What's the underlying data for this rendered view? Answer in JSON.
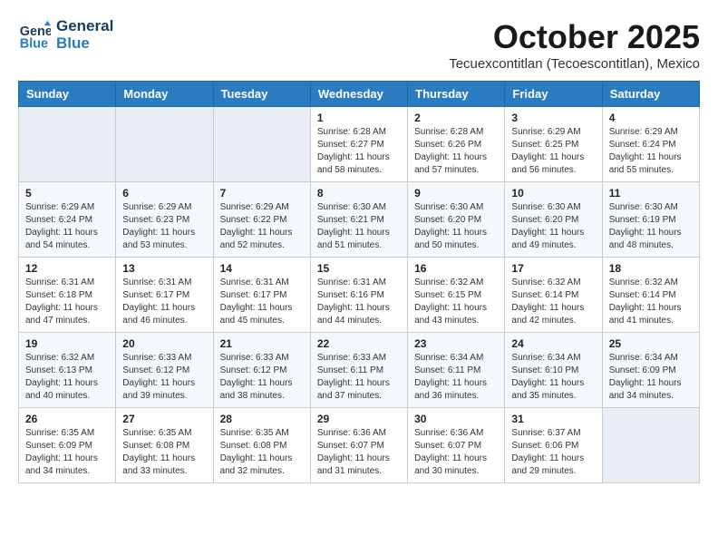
{
  "header": {
    "logo_line1": "General",
    "logo_line2": "Blue",
    "month": "October 2025",
    "location": "Tecuexcontitlan (Tecoescontitlan), Mexico"
  },
  "weekdays": [
    "Sunday",
    "Monday",
    "Tuesday",
    "Wednesday",
    "Thursday",
    "Friday",
    "Saturday"
  ],
  "weeks": [
    [
      {
        "day": "",
        "info": ""
      },
      {
        "day": "",
        "info": ""
      },
      {
        "day": "",
        "info": ""
      },
      {
        "day": "1",
        "info": "Sunrise: 6:28 AM\nSunset: 6:27 PM\nDaylight: 11 hours\nand 58 minutes."
      },
      {
        "day": "2",
        "info": "Sunrise: 6:28 AM\nSunset: 6:26 PM\nDaylight: 11 hours\nand 57 minutes."
      },
      {
        "day": "3",
        "info": "Sunrise: 6:29 AM\nSunset: 6:25 PM\nDaylight: 11 hours\nand 56 minutes."
      },
      {
        "day": "4",
        "info": "Sunrise: 6:29 AM\nSunset: 6:24 PM\nDaylight: 11 hours\nand 55 minutes."
      }
    ],
    [
      {
        "day": "5",
        "info": "Sunrise: 6:29 AM\nSunset: 6:24 PM\nDaylight: 11 hours\nand 54 minutes."
      },
      {
        "day": "6",
        "info": "Sunrise: 6:29 AM\nSunset: 6:23 PM\nDaylight: 11 hours\nand 53 minutes."
      },
      {
        "day": "7",
        "info": "Sunrise: 6:29 AM\nSunset: 6:22 PM\nDaylight: 11 hours\nand 52 minutes."
      },
      {
        "day": "8",
        "info": "Sunrise: 6:30 AM\nSunset: 6:21 PM\nDaylight: 11 hours\nand 51 minutes."
      },
      {
        "day": "9",
        "info": "Sunrise: 6:30 AM\nSunset: 6:20 PM\nDaylight: 11 hours\nand 50 minutes."
      },
      {
        "day": "10",
        "info": "Sunrise: 6:30 AM\nSunset: 6:20 PM\nDaylight: 11 hours\nand 49 minutes."
      },
      {
        "day": "11",
        "info": "Sunrise: 6:30 AM\nSunset: 6:19 PM\nDaylight: 11 hours\nand 48 minutes."
      }
    ],
    [
      {
        "day": "12",
        "info": "Sunrise: 6:31 AM\nSunset: 6:18 PM\nDaylight: 11 hours\nand 47 minutes."
      },
      {
        "day": "13",
        "info": "Sunrise: 6:31 AM\nSunset: 6:17 PM\nDaylight: 11 hours\nand 46 minutes."
      },
      {
        "day": "14",
        "info": "Sunrise: 6:31 AM\nSunset: 6:17 PM\nDaylight: 11 hours\nand 45 minutes."
      },
      {
        "day": "15",
        "info": "Sunrise: 6:31 AM\nSunset: 6:16 PM\nDaylight: 11 hours\nand 44 minutes."
      },
      {
        "day": "16",
        "info": "Sunrise: 6:32 AM\nSunset: 6:15 PM\nDaylight: 11 hours\nand 43 minutes."
      },
      {
        "day": "17",
        "info": "Sunrise: 6:32 AM\nSunset: 6:14 PM\nDaylight: 11 hours\nand 42 minutes."
      },
      {
        "day": "18",
        "info": "Sunrise: 6:32 AM\nSunset: 6:14 PM\nDaylight: 11 hours\nand 41 minutes."
      }
    ],
    [
      {
        "day": "19",
        "info": "Sunrise: 6:32 AM\nSunset: 6:13 PM\nDaylight: 11 hours\nand 40 minutes."
      },
      {
        "day": "20",
        "info": "Sunrise: 6:33 AM\nSunset: 6:12 PM\nDaylight: 11 hours\nand 39 minutes."
      },
      {
        "day": "21",
        "info": "Sunrise: 6:33 AM\nSunset: 6:12 PM\nDaylight: 11 hours\nand 38 minutes."
      },
      {
        "day": "22",
        "info": "Sunrise: 6:33 AM\nSunset: 6:11 PM\nDaylight: 11 hours\nand 37 minutes."
      },
      {
        "day": "23",
        "info": "Sunrise: 6:34 AM\nSunset: 6:11 PM\nDaylight: 11 hours\nand 36 minutes."
      },
      {
        "day": "24",
        "info": "Sunrise: 6:34 AM\nSunset: 6:10 PM\nDaylight: 11 hours\nand 35 minutes."
      },
      {
        "day": "25",
        "info": "Sunrise: 6:34 AM\nSunset: 6:09 PM\nDaylight: 11 hours\nand 34 minutes."
      }
    ],
    [
      {
        "day": "26",
        "info": "Sunrise: 6:35 AM\nSunset: 6:09 PM\nDaylight: 11 hours\nand 34 minutes."
      },
      {
        "day": "27",
        "info": "Sunrise: 6:35 AM\nSunset: 6:08 PM\nDaylight: 11 hours\nand 33 minutes."
      },
      {
        "day": "28",
        "info": "Sunrise: 6:35 AM\nSunset: 6:08 PM\nDaylight: 11 hours\nand 32 minutes."
      },
      {
        "day": "29",
        "info": "Sunrise: 6:36 AM\nSunset: 6:07 PM\nDaylight: 11 hours\nand 31 minutes."
      },
      {
        "day": "30",
        "info": "Sunrise: 6:36 AM\nSunset: 6:07 PM\nDaylight: 11 hours\nand 30 minutes."
      },
      {
        "day": "31",
        "info": "Sunrise: 6:37 AM\nSunset: 6:06 PM\nDaylight: 11 hours\nand 29 minutes."
      },
      {
        "day": "",
        "info": ""
      }
    ]
  ]
}
